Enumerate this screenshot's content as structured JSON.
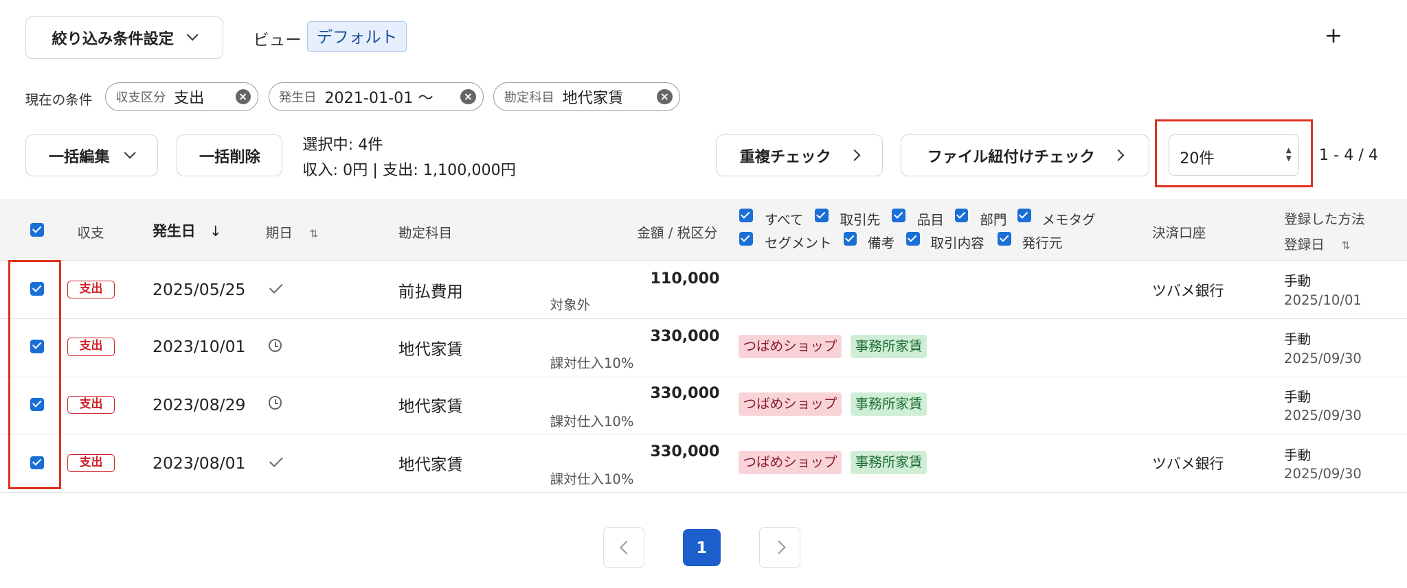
{
  "toolbar": {
    "filter_settings_label": "絞り込み条件設定",
    "view_label": "ビュー",
    "view_value": "デフォルト",
    "add_symbol": "+"
  },
  "conditions": {
    "label": "現在の条件",
    "chips": [
      {
        "key": "収支区分",
        "value": "支出"
      },
      {
        "key": "発生日",
        "value": "2021-01-01 〜"
      },
      {
        "key": "勘定科目",
        "value": "地代家賃"
      }
    ]
  },
  "actions": {
    "bulk_edit": "一括編集",
    "bulk_delete": "一括削除",
    "selected_text": "選択中: 4件",
    "summary_text": "収入: 0円 | 支出: 1,100,000円",
    "duplicate_check": "重複チェック",
    "file_link_check": "ファイル紐付けチェック",
    "page_size": "20件",
    "range_text": "1 - 4 / 4"
  },
  "table": {
    "headers": {
      "type": "収支",
      "date": "発生日",
      "due": "期日",
      "account": "勘定科目",
      "amount": "金額 / 税区分",
      "settlement": "決済口座",
      "method": "登録した方法",
      "registered": "登録日"
    },
    "tag_options": [
      "すべて",
      "取引先",
      "品目",
      "部門",
      "メモタグ",
      "セグメント",
      "備考",
      "取引内容",
      "発行元"
    ],
    "rows": [
      {
        "type": "支出",
        "date": "2025/05/25",
        "due_icon": "check-icon",
        "account": "前払費用",
        "amount": "110,000",
        "tax": "対象外",
        "partner": "",
        "item": "",
        "settlement": "ツバメ銀行",
        "method": "手動",
        "registered": "2025/10/01"
      },
      {
        "type": "支出",
        "date": "2023/10/01",
        "due_icon": "clock-icon",
        "account": "地代家賃",
        "amount": "330,000",
        "tax": "課対仕入10%",
        "partner": "つばめショップ",
        "item": "事務所家賃",
        "settlement": "",
        "method": "手動",
        "registered": "2025/09/30"
      },
      {
        "type": "支出",
        "date": "2023/08/29",
        "due_icon": "clock-icon",
        "account": "地代家賃",
        "amount": "330,000",
        "tax": "課対仕入10%",
        "partner": "つばめショップ",
        "item": "事務所家賃",
        "settlement": "",
        "method": "手動",
        "registered": "2025/09/30"
      },
      {
        "type": "支出",
        "date": "2023/08/01",
        "due_icon": "check-icon",
        "account": "地代家賃",
        "amount": "330,000",
        "tax": "課対仕入10%",
        "partner": "つばめショップ",
        "item": "事務所家賃",
        "settlement": "ツバメ銀行",
        "method": "手動",
        "registered": "2025/09/30"
      }
    ]
  },
  "pagination": {
    "current": "1"
  },
  "colors": {
    "accent": "#1a6fd6",
    "expense": "#d0202a",
    "highlight": "#e0301e",
    "partner_tag": "#f8d3d8",
    "item_tag": "#cfeed5"
  }
}
